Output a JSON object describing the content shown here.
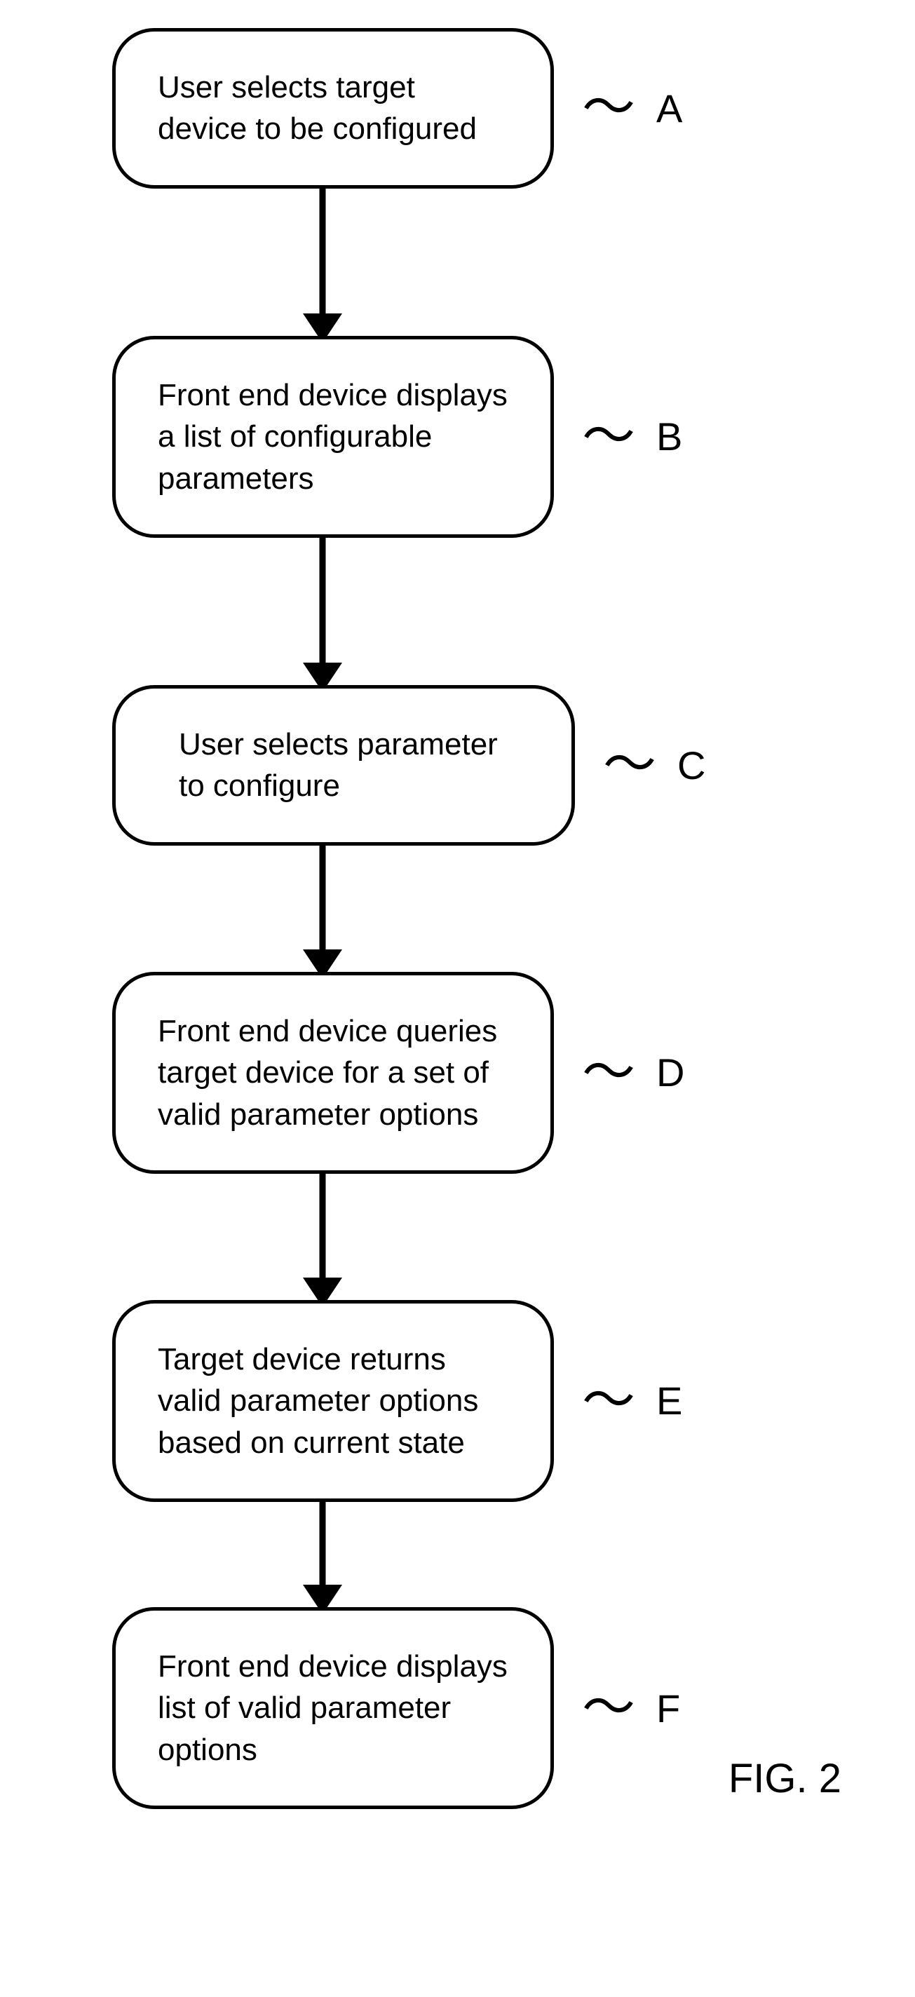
{
  "chart_data": {
    "type": "flowchart",
    "steps": [
      {
        "label": "A",
        "text": "User selects\ntarget device\nto be configured"
      },
      {
        "label": "B",
        "text": "Front end device\ndisplays a list of\nconfigurable\nparameters"
      },
      {
        "label": "C",
        "text": "User selects\nparameter to\nconfigure"
      },
      {
        "label": "D",
        "text": "Front end device\nqueries target device\nfor a set of valid\nparameter options"
      },
      {
        "label": "E",
        "text": "Target device returns\nvalid parameter options\nbased on current state"
      },
      {
        "label": "F",
        "text": "Front end device\ndisplays list of valid\nparameter options"
      }
    ]
  },
  "figure_label": "FIG. 2",
  "steps": {
    "a": {
      "text": "User selects target device to be configured",
      "label": "A"
    },
    "b": {
      "text": "Front end device displays a list of configurable parameters",
      "label": "B"
    },
    "c": {
      "text": "User selects parameter to configure",
      "label": "C"
    },
    "d": {
      "text": "Front end device queries target device for a set of valid parameter options",
      "label": "D"
    },
    "e": {
      "text": "Target device returns valid parameter options based on current state",
      "label": "E"
    },
    "f": {
      "text": "Front end device displays list of valid parameter options",
      "label": "F"
    }
  }
}
